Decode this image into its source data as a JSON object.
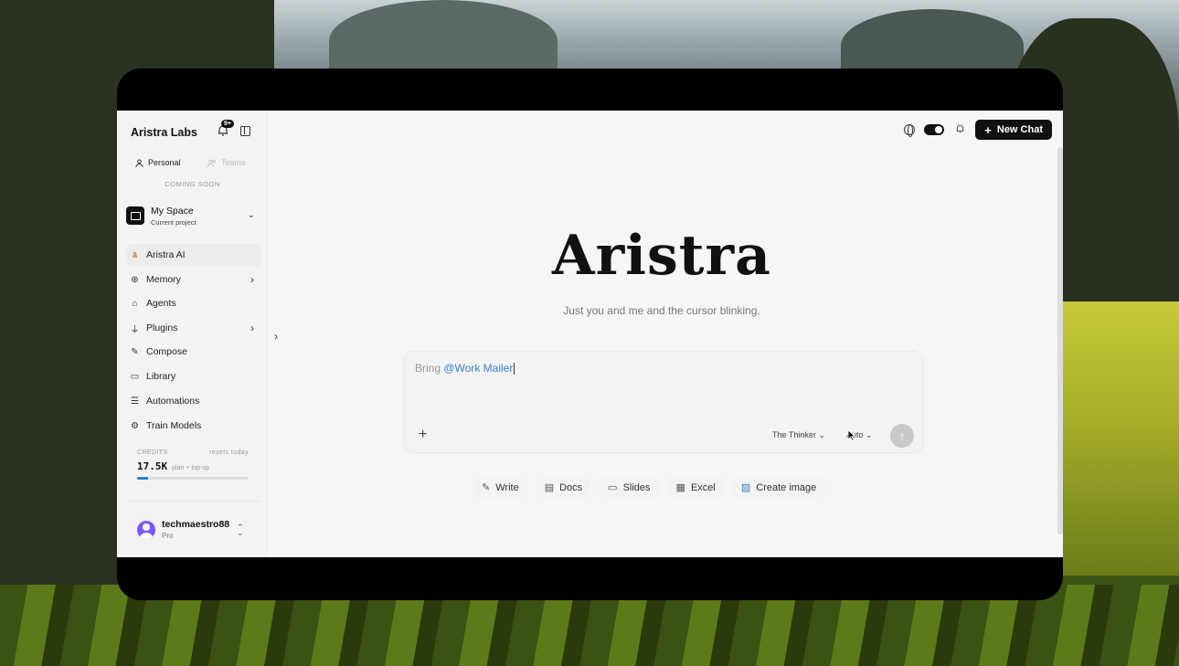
{
  "app": {
    "brand": "Aristra Labs",
    "notification_badge": "9+"
  },
  "tabs": {
    "personal": "Personal",
    "teams": "Teams",
    "coming_soon": "COMING SOON"
  },
  "space": {
    "title": "My Space",
    "subtitle": "Current project"
  },
  "nav": [
    {
      "label": "Aristra AI",
      "icon": "aristra-logo-icon",
      "active": true
    },
    {
      "label": "Memory",
      "icon": "brain-icon",
      "has_submenu": true
    },
    {
      "label": "Agents",
      "icon": "robot-icon"
    },
    {
      "label": "Plugins",
      "icon": "plug-icon",
      "has_submenu": true
    },
    {
      "label": "Compose",
      "icon": "pencil-icon"
    },
    {
      "label": "Library",
      "icon": "book-icon"
    },
    {
      "label": "Automations",
      "icon": "list-check-icon"
    },
    {
      "label": "Train Models",
      "icon": "gear-chip-icon"
    }
  ],
  "credits": {
    "label": "CREDITS",
    "reset": "resets today",
    "amount": "17.5K",
    "detail": "plan + top-up",
    "usage_fraction": 0.1
  },
  "user": {
    "name": "techmaestro88",
    "plan": "Pro"
  },
  "header": {
    "new_chat": "New Chat"
  },
  "hero": {
    "title": "Aristra",
    "tagline": "Just you and me and the cursor blinking."
  },
  "composer": {
    "prefix": "Bring ",
    "mention": "@Work Mailer",
    "model": "The Thinker",
    "mode": "Auto"
  },
  "actions": [
    {
      "label": "Write",
      "icon": "pencil-icon"
    },
    {
      "label": "Docs",
      "icon": "document-icon"
    },
    {
      "label": "Slides",
      "icon": "monitor-icon"
    },
    {
      "label": "Excel",
      "icon": "table-icon"
    },
    {
      "label": "Create image",
      "icon": "image-icon"
    }
  ],
  "colors": {
    "accent": "#2b82d9",
    "mention": "#3f7ec6",
    "primary_button": "#111111"
  }
}
